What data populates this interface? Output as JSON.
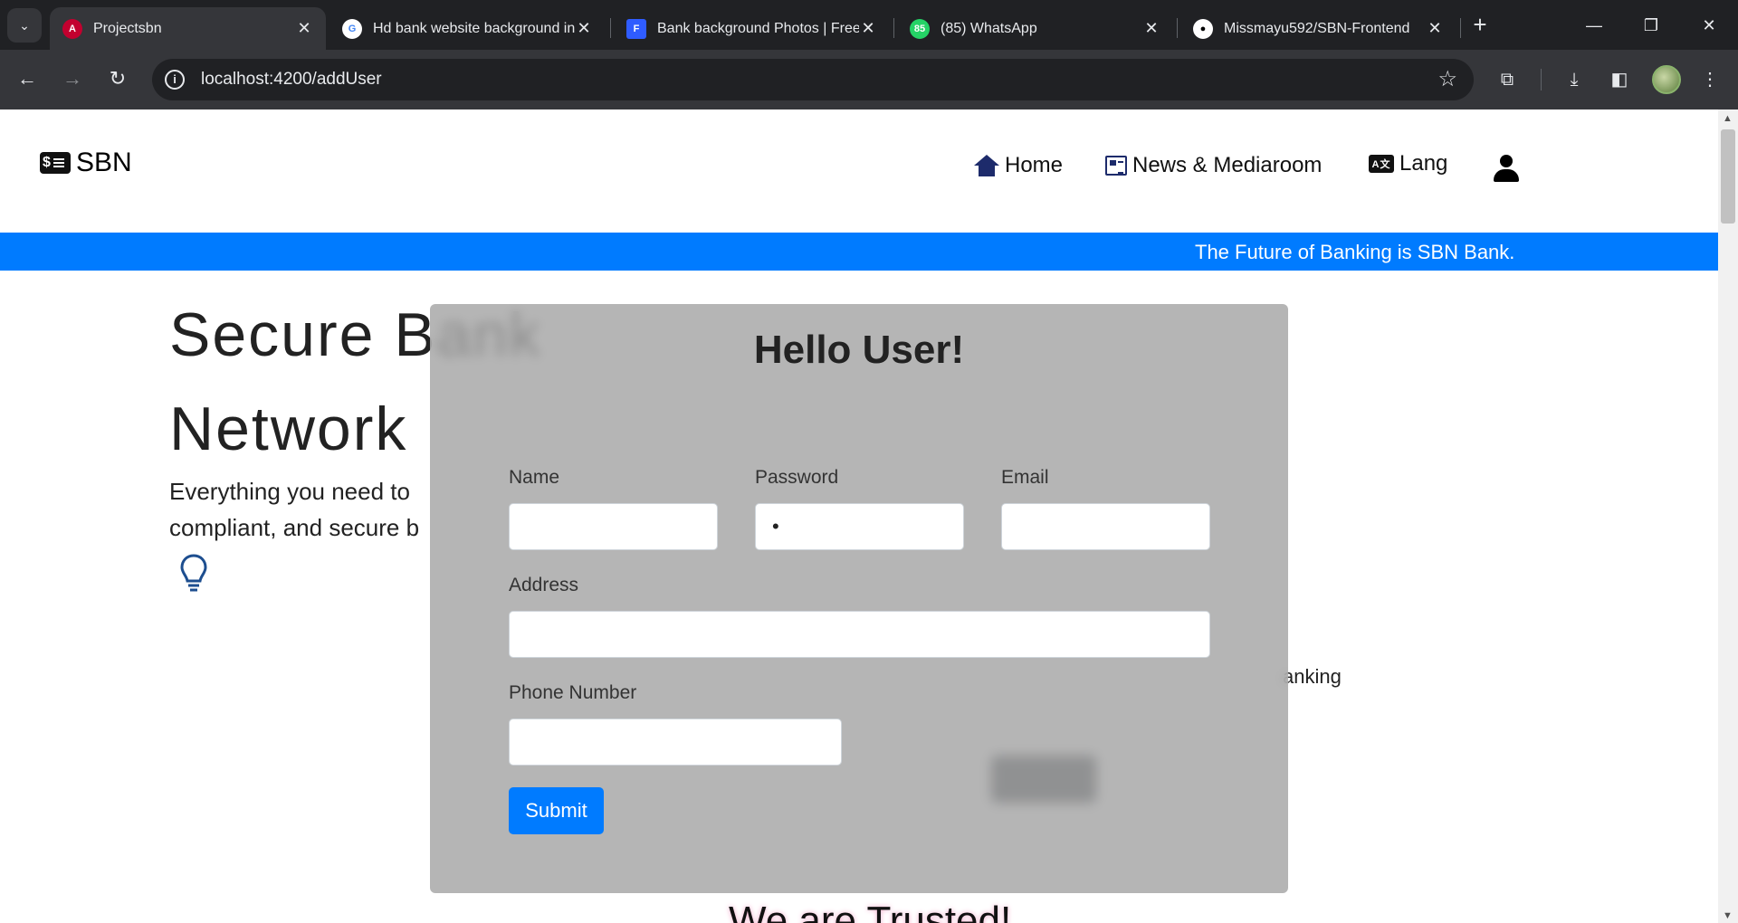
{
  "browser": {
    "tabs": [
      {
        "title": "Projectsbn",
        "icon": "angular-icon"
      },
      {
        "title": "Hd bank website background in",
        "icon": "google-icon"
      },
      {
        "title": "Bank background Photos | Free",
        "icon": "freepik-icon"
      },
      {
        "title": "(85) WhatsApp",
        "icon": "whatsapp-icon",
        "badge": "85"
      },
      {
        "title": "Missmayu592/SBN-Frontend",
        "icon": "github-icon"
      }
    ],
    "url": "localhost:4200/addUser"
  },
  "navbar": {
    "brand": "SBN",
    "home": "Home",
    "news": "News & Mediaroom",
    "lang": "Lang",
    "lang_badge": "A文"
  },
  "banner": {
    "text": "The Future of Banking is SBN Bank.",
    "color": "#007bff"
  },
  "hero": {
    "title_line1": "Secure Bank",
    "title_line2": "Network",
    "desc_line1": "Everything you need to",
    "desc_line2": "compliant, and secure b",
    "right_text": "anking"
  },
  "trusted": "We are Trusted!",
  "modal": {
    "title": "Hello User!",
    "fields": {
      "name": {
        "label": "Name",
        "value": ""
      },
      "password": {
        "label": "Password",
        "value": "•"
      },
      "email": {
        "label": "Email",
        "value": ""
      },
      "address": {
        "label": "Address",
        "value": ""
      },
      "phone": {
        "label": "Phone Number",
        "value": ""
      }
    },
    "submit": "Submit"
  }
}
